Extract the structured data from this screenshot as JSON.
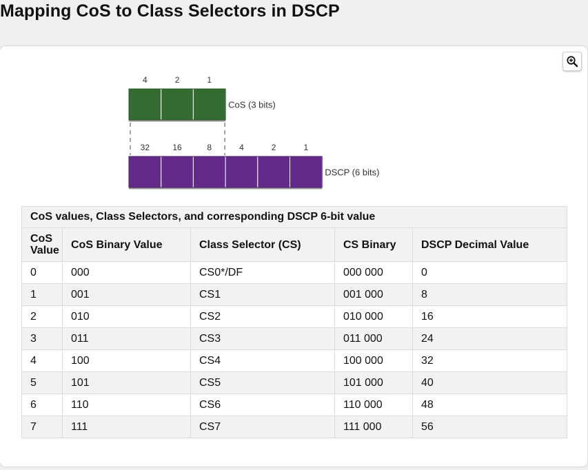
{
  "page": {
    "title": "Mapping CoS to Class Selectors in DSCP"
  },
  "zoom_button": {
    "icon": "zoom-in-icon"
  },
  "diagram": {
    "cos_bits": [
      "4",
      "2",
      "1"
    ],
    "cos_label": "CoS (3 bits)",
    "cos_color": "#346b30",
    "dscp_bits": [
      "32",
      "16",
      "8",
      "4",
      "2",
      "1"
    ],
    "dscp_label": "DSCP (6 bits)",
    "dscp_color": "#642a8a"
  },
  "table": {
    "caption": "CoS values, Class Selectors, and corresponding DSCP 6-bit value",
    "headers": [
      "CoS Value",
      "CoS Binary Value",
      "Class Selector (CS)",
      "CS Binary",
      "DSCP Decimal Value"
    ],
    "rows": [
      [
        "0",
        "000",
        "CS0*/DF",
        "000 000",
        "0"
      ],
      [
        "1",
        "001",
        "CS1",
        "001 000",
        "8"
      ],
      [
        "2",
        "010",
        "CS2",
        "010 000",
        "16"
      ],
      [
        "3",
        "011",
        "CS3",
        "011 000",
        "24"
      ],
      [
        "4",
        "100",
        "CS4",
        "100 000",
        "32"
      ],
      [
        "5",
        "101",
        "CS5",
        "101 000",
        "40"
      ],
      [
        "6",
        "110",
        "CS6",
        "110 000",
        "48"
      ],
      [
        "7",
        "111",
        "CS7",
        "111 000",
        "56"
      ]
    ]
  }
}
